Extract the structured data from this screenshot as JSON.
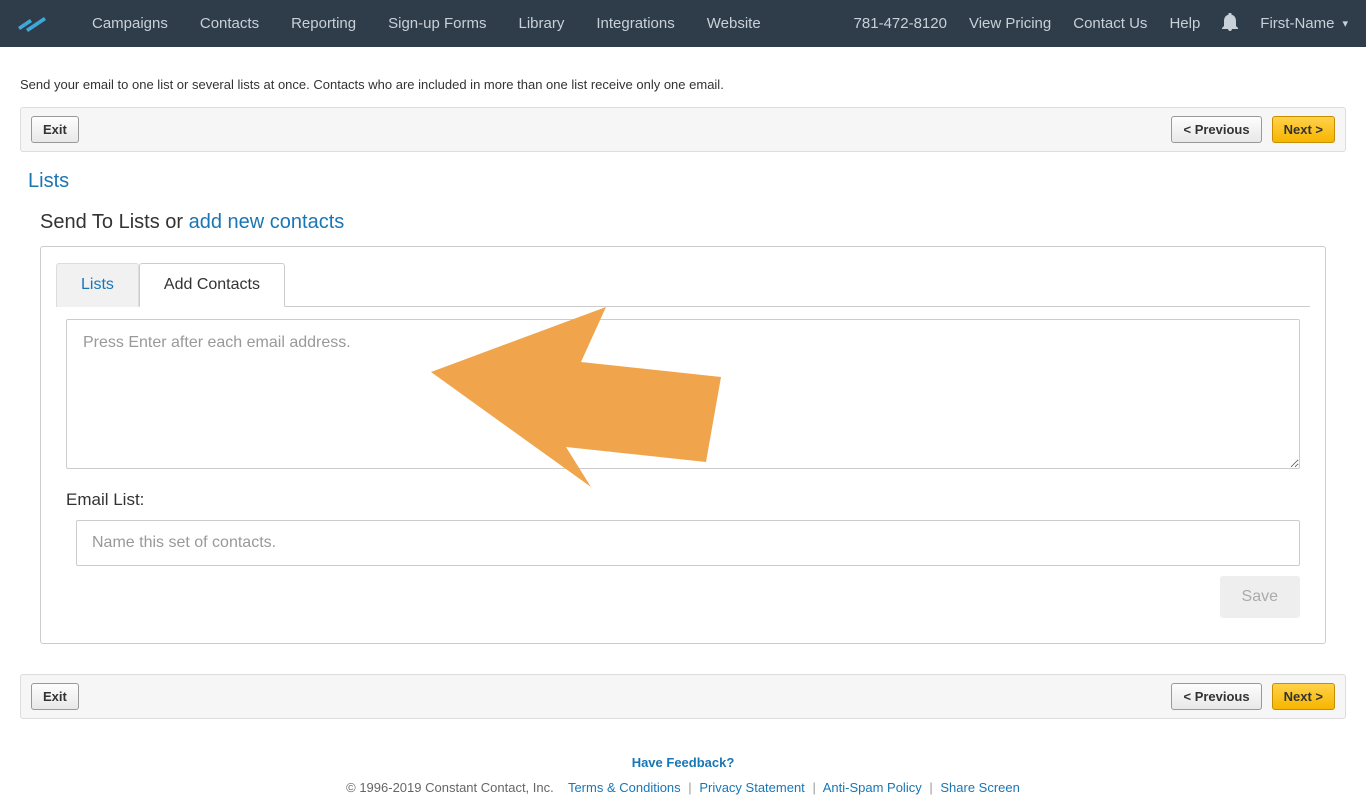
{
  "nav": {
    "items": [
      "Campaigns",
      "Contacts",
      "Reporting",
      "Sign-up Forms",
      "Library",
      "Integrations",
      "Website"
    ],
    "phone": "781-472-8120",
    "pricing": "View Pricing",
    "contact": "Contact Us",
    "help": "Help",
    "user": "First-Name"
  },
  "intro": "Send your email to one list or several lists at once. Contacts who are included in more than one list receive only one email.",
  "actions": {
    "exit": "Exit",
    "previous": "< Previous",
    "next": "Next >"
  },
  "section_title": "Lists",
  "subtitle_prefix": "Send To Lists or ",
  "subtitle_link": "add new contacts",
  "tabs": {
    "lists": "Lists",
    "add_contacts": "Add Contacts"
  },
  "form": {
    "email_placeholder": "Press Enter after each email address.",
    "list_label": "Email List:",
    "list_placeholder": "Name this set of contacts.",
    "save": "Save"
  },
  "footer": {
    "feedback": "Have Feedback?",
    "copyright": "© 1996-2019 Constant Contact, Inc.",
    "terms": "Terms & Conditions",
    "privacy": "Privacy Statement",
    "antispam": "Anti-Spam Policy",
    "share": "Share Screen"
  }
}
